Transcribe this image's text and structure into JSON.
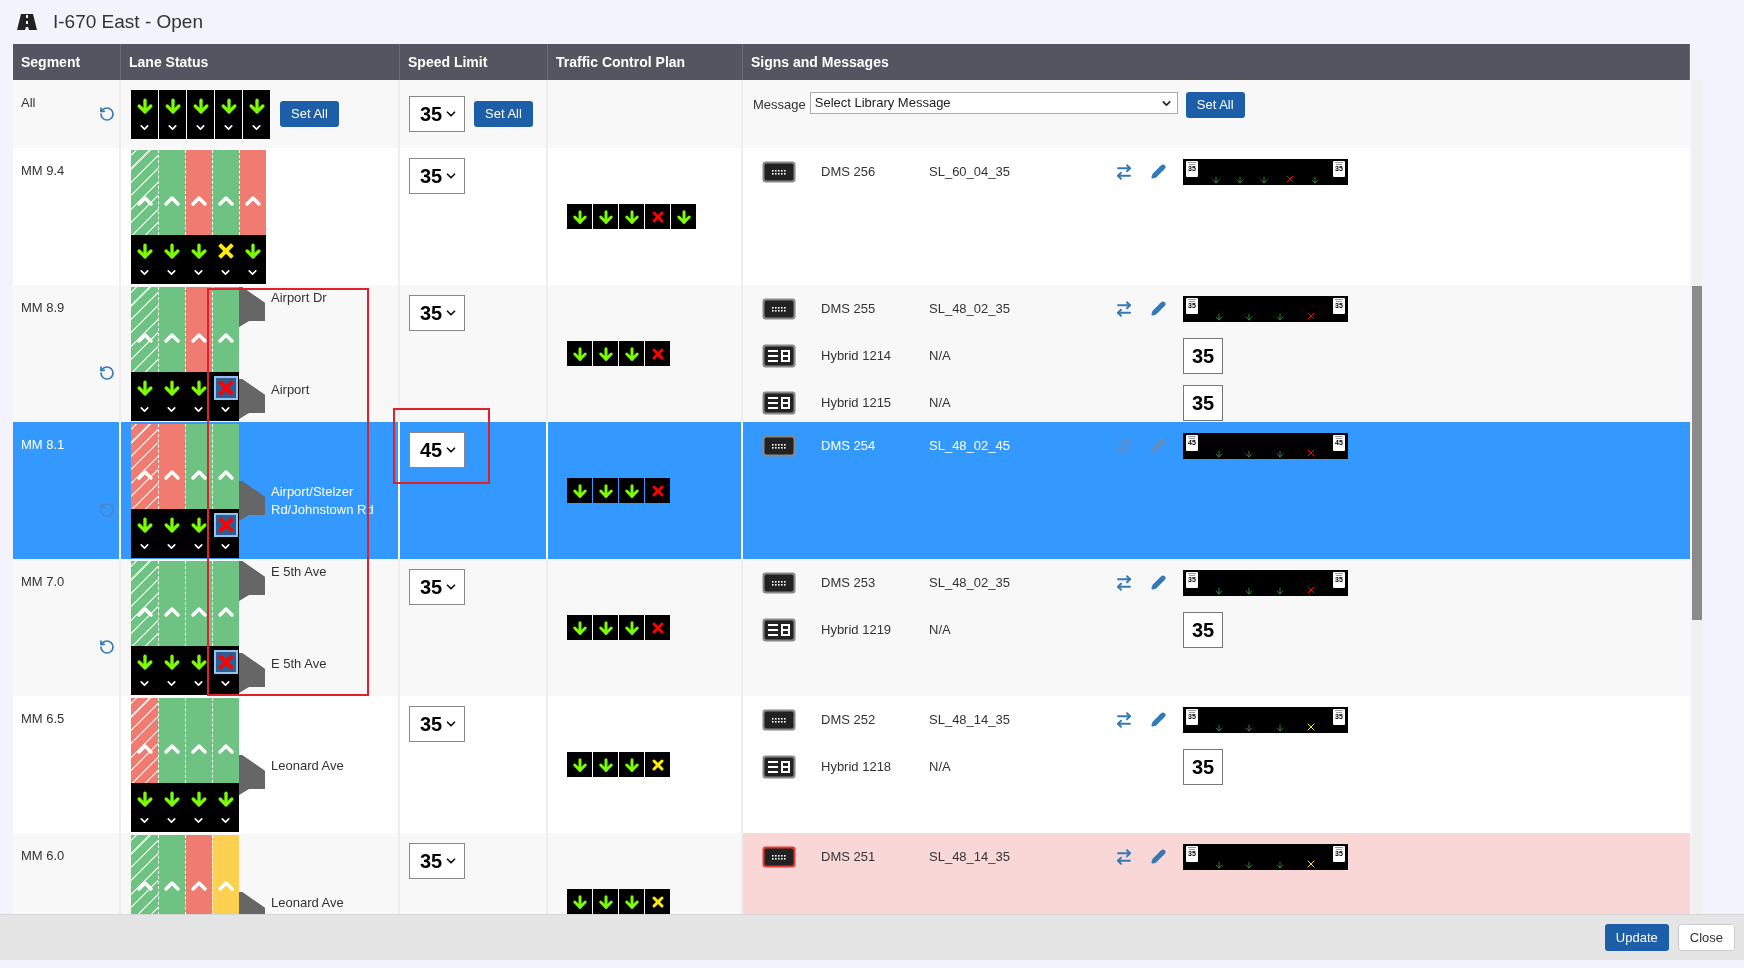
{
  "title": "I-670 East - Open",
  "columns": [
    "Segment",
    "Lane Status",
    "Speed Limit",
    "Traffic Control Plan",
    "Signs and Messages"
  ],
  "all_row": {
    "segment": "All",
    "modified": true,
    "lane_signals": [
      {
        "kind": "arrow"
      },
      {
        "kind": "arrow"
      },
      {
        "kind": "arrow"
      },
      {
        "kind": "arrow"
      },
      {
        "kind": "arrow"
      }
    ],
    "set_all": "Set All",
    "speed": "35",
    "speed_set_all": "Set All",
    "message_label": "Message",
    "message_select": "Select Library Message",
    "message_set_all": "Set All"
  },
  "rows": [
    {
      "segment": "MM 9.4",
      "selected": false,
      "modified": false,
      "lanes": [
        {
          "color": "#6fc382",
          "hatched": true,
          "signal": {
            "kind": "arrow",
            "selected": false
          }
        },
        {
          "color": "#6fc382",
          "hatched": false,
          "signal": {
            "kind": "arrow",
            "selected": false
          }
        },
        {
          "color": "#f07b70",
          "hatched": false,
          "signal": {
            "kind": "arrow",
            "selected": false
          }
        },
        {
          "color": "#6fc382",
          "hatched": false,
          "signal": {
            "kind": "x",
            "color": "#ffee00",
            "selected": false
          }
        },
        {
          "color": "#f07b70",
          "hatched": false,
          "signal": {
            "kind": "arrow",
            "selected": false
          }
        }
      ],
      "ramps": [],
      "speed": "35",
      "control_plan": [
        {
          "kind": "arrow"
        },
        {
          "kind": "arrow"
        },
        {
          "kind": "arrow"
        },
        {
          "kind": "x",
          "color": "#ff0000"
        },
        {
          "kind": "arrow"
        }
      ],
      "signs": [
        {
          "kind": "dms",
          "name": "DMS 256",
          "message": "SL_60_04_35",
          "alarm": false,
          "preview": {
            "speeds": [
              "35",
              "35"
            ],
            "marks": [
              {
                "kind": "arrow"
              },
              {
                "kind": "arrow"
              },
              {
                "kind": "arrow"
              },
              {
                "kind": "x",
                "color": "#ff0000"
              },
              {
                "kind": "arrow"
              }
            ]
          }
        }
      ]
    },
    {
      "segment": "MM 8.9",
      "selected": false,
      "modified": true,
      "lanes": [
        {
          "color": "#6fc382",
          "hatched": true,
          "signal": {
            "kind": "arrow",
            "selected": false
          }
        },
        {
          "color": "#6fc382",
          "hatched": false,
          "signal": {
            "kind": "arrow",
            "selected": false
          }
        },
        {
          "color": "#f07b70",
          "hatched": false,
          "signal": {
            "kind": "arrow",
            "selected": false
          }
        },
        {
          "color": "#6fc382",
          "hatched": false,
          "signal": {
            "kind": "x",
            "color": "#ff0000",
            "selected": true
          }
        }
      ],
      "ramps": [
        "Airport Dr",
        "Airport"
      ],
      "speed": "35",
      "control_plan": [
        {
          "kind": "arrow"
        },
        {
          "kind": "arrow"
        },
        {
          "kind": "arrow"
        },
        {
          "kind": "x",
          "color": "#ff0000"
        }
      ],
      "signs": [
        {
          "kind": "dms",
          "name": "DMS 255",
          "message": "SL_48_02_35",
          "alarm": false,
          "preview": {
            "speeds": [
              "35",
              "35"
            ],
            "marks": [
              {
                "kind": "arrow"
              },
              {
                "kind": "arrow"
              },
              {
                "kind": "arrow"
              },
              {
                "kind": "x",
                "color": "#ff0000"
              }
            ]
          }
        },
        {
          "kind": "hybrid",
          "name": "Hybrid 1214",
          "message": "N/A",
          "alarm": false,
          "display": "35"
        },
        {
          "kind": "hybrid",
          "name": "Hybrid 1215",
          "message": "N/A",
          "alarm": false,
          "display": "35"
        }
      ]
    },
    {
      "segment": "MM 8.1",
      "selected": true,
      "modified": true,
      "lanes": [
        {
          "color": "#f07b70",
          "hatched": true,
          "signal": {
            "kind": "arrow",
            "selected": false
          }
        },
        {
          "color": "#f07b70",
          "hatched": false,
          "signal": {
            "kind": "arrow",
            "selected": false
          }
        },
        {
          "color": "#6fc382",
          "hatched": false,
          "signal": {
            "kind": "arrow",
            "selected": false
          }
        },
        {
          "color": "#6fc382",
          "hatched": false,
          "signal": {
            "kind": "x",
            "color": "#ff0000",
            "selected": true
          }
        }
      ],
      "ramps": [
        "Airport/Stelzer Rd/Johnstown Rd"
      ],
      "speed": "45",
      "control_plan": [
        {
          "kind": "arrow"
        },
        {
          "kind": "arrow"
        },
        {
          "kind": "arrow"
        },
        {
          "kind": "x",
          "color": "#ff0000"
        }
      ],
      "signs": [
        {
          "kind": "dms",
          "name": "DMS 254",
          "message": "SL_48_02_45",
          "alarm": false,
          "preview": {
            "speeds": [
              "45",
              "45"
            ],
            "marks": [
              {
                "kind": "arrow"
              },
              {
                "kind": "arrow"
              },
              {
                "kind": "arrow"
              },
              {
                "kind": "x",
                "color": "#ff0000"
              }
            ]
          }
        }
      ]
    },
    {
      "segment": "MM 7.0",
      "selected": false,
      "modified": true,
      "lanes": [
        {
          "color": "#6fc382",
          "hatched": true,
          "signal": {
            "kind": "arrow",
            "selected": false
          }
        },
        {
          "color": "#6fc382",
          "hatched": false,
          "signal": {
            "kind": "arrow",
            "selected": false
          }
        },
        {
          "color": "#6fc382",
          "hatched": false,
          "signal": {
            "kind": "arrow",
            "selected": false
          }
        },
        {
          "color": "#6fc382",
          "hatched": false,
          "signal": {
            "kind": "x",
            "color": "#ff0000",
            "selected": true
          }
        }
      ],
      "ramps": [
        "E 5th Ave",
        "E 5th Ave"
      ],
      "speed": "35",
      "control_plan": [
        {
          "kind": "arrow"
        },
        {
          "kind": "arrow"
        },
        {
          "kind": "arrow"
        },
        {
          "kind": "x",
          "color": "#ff0000"
        }
      ],
      "signs": [
        {
          "kind": "dms",
          "name": "DMS 253",
          "message": "SL_48_02_35",
          "alarm": false,
          "preview": {
            "speeds": [
              "35",
              "35"
            ],
            "marks": [
              {
                "kind": "arrow"
              },
              {
                "kind": "arrow"
              },
              {
                "kind": "arrow"
              },
              {
                "kind": "x",
                "color": "#ff0000"
              }
            ]
          }
        },
        {
          "kind": "hybrid",
          "name": "Hybrid 1219",
          "message": "N/A",
          "alarm": false,
          "display": "35"
        }
      ]
    },
    {
      "segment": "MM 6.5",
      "selected": false,
      "modified": false,
      "lanes": [
        {
          "color": "#f07b70",
          "hatched": true,
          "signal": {
            "kind": "arrow",
            "selected": false
          }
        },
        {
          "color": "#6fc382",
          "hatched": false,
          "signal": {
            "kind": "arrow",
            "selected": false
          }
        },
        {
          "color": "#6fc382",
          "hatched": false,
          "signal": {
            "kind": "arrow",
            "selected": false
          }
        },
        {
          "color": "#6fc382",
          "hatched": false,
          "signal": {
            "kind": "arrow",
            "selected": false
          }
        }
      ],
      "ramps": [
        "Leonard Ave"
      ],
      "speed": "35",
      "control_plan": [
        {
          "kind": "arrow"
        },
        {
          "kind": "arrow"
        },
        {
          "kind": "arrow"
        },
        {
          "kind": "x",
          "color": "#ffee00"
        }
      ],
      "signs": [
        {
          "kind": "dms",
          "name": "DMS 252",
          "message": "SL_48_14_35",
          "alarm": false,
          "preview": {
            "speeds": [
              "35",
              "35"
            ],
            "marks": [
              {
                "kind": "arrow"
              },
              {
                "kind": "arrow"
              },
              {
                "kind": "arrow"
              },
              {
                "kind": "x",
                "color": "#ffee00"
              }
            ]
          }
        },
        {
          "kind": "hybrid",
          "name": "Hybrid 1218",
          "message": "N/A",
          "alarm": false,
          "display": "35"
        }
      ]
    },
    {
      "segment": "MM 6.0",
      "selected": false,
      "modified": false,
      "lanes": [
        {
          "color": "#6fc382",
          "hatched": true
        },
        {
          "color": "#6fc382",
          "hatched": false
        },
        {
          "color": "#f07b70",
          "hatched": false
        },
        {
          "color": "#fdd052",
          "hatched": false
        }
      ],
      "ramps": [
        "Leonard Ave"
      ],
      "speed": "35",
      "control_plan": [
        {
          "kind": "arrow"
        },
        {
          "kind": "arrow"
        },
        {
          "kind": "arrow"
        },
        {
          "kind": "x",
          "color": "#ffee00"
        }
      ],
      "signs": [
        {
          "kind": "dms",
          "name": "DMS 251",
          "message": "SL_48_14_35",
          "alarm": true,
          "preview": {
            "speeds": [
              "35",
              "35"
            ],
            "marks": [
              {
                "kind": "arrow"
              },
              {
                "kind": "arrow"
              },
              {
                "kind": "arrow"
              },
              {
                "kind": "x",
                "color": "#ffee00"
              }
            ]
          }
        }
      ]
    }
  ],
  "buttons": [
    {
      "label": "Update",
      "kind": "primary"
    },
    {
      "label": "Close",
      "kind": "default"
    }
  ]
}
